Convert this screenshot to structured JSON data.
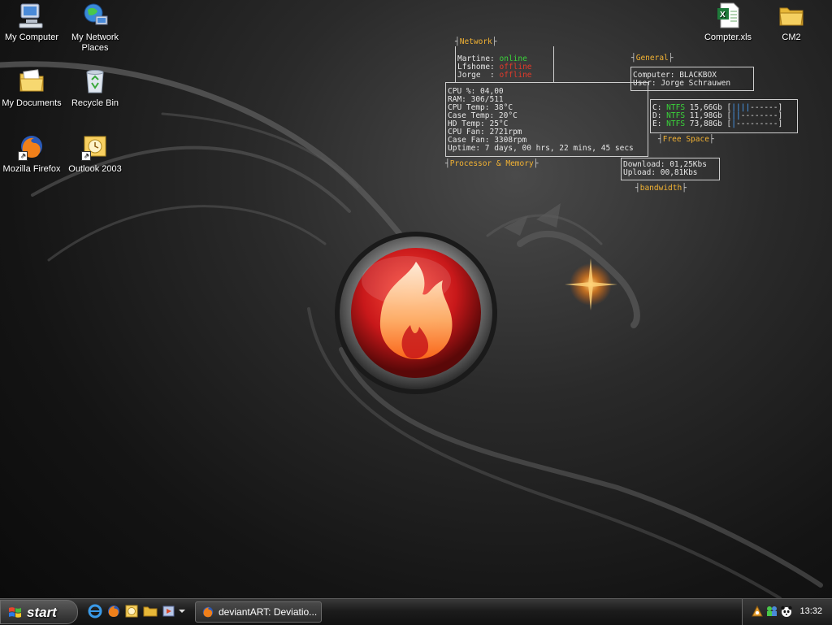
{
  "desktop_icons": [
    {
      "label": "My Computer",
      "icon": "my-computer-icon"
    },
    {
      "label": "My Network Places",
      "icon": "network-places-icon"
    },
    {
      "label": "My Documents",
      "icon": "documents-folder-icon"
    },
    {
      "label": "Recycle Bin",
      "icon": "recycle-bin-icon"
    },
    {
      "label": "Mozilla Firefox",
      "icon": "firefox-icon"
    },
    {
      "label": "Outlook 2003",
      "icon": "outlook-icon"
    },
    {
      "label": "Compter.xls",
      "icon": "excel-file-icon"
    },
    {
      "label": "CM2",
      "icon": "folder-icon"
    }
  ],
  "conky": {
    "network": {
      "title": "Network",
      "hosts": [
        {
          "name": "Martine: ",
          "status": "online"
        },
        {
          "name": "Lfshome: ",
          "status": "offline"
        },
        {
          "name": "Jorge  : ",
          "status": "offline"
        }
      ]
    },
    "general": {
      "title": "General",
      "computer": "Computer: BLACKBOX",
      "user": "User: Jorge Schrauwen"
    },
    "processor": {
      "title": "Processor & Memory",
      "lines": [
        "CPU %: 04,00",
        "RAM: 306/511",
        "CPU Temp: 38°C",
        "Case Temp: 20°C",
        "HD Temp: 25°C",
        "CPU Fan: 2721rpm",
        "Case Fan: 3308rpm",
        "Uptime: 7 days, 00 hrs, 22 mins, 45 secs"
      ]
    },
    "free_space": {
      "title": "Free Space",
      "drives": [
        {
          "drive": "C: ",
          "fs": "NTFS",
          "size": " 15,66Gb ",
          "bar_used": "||||",
          "bar_free": "------"
        },
        {
          "drive": "D: ",
          "fs": "NTFS",
          "size": " 11,98Gb ",
          "bar_used": "||",
          "bar_free": "--------"
        },
        {
          "drive": "E: ",
          "fs": "NTFS",
          "size": " 73,88Gb ",
          "bar_used": "|",
          "bar_free": "---------"
        }
      ]
    },
    "bandwidth": {
      "title": "bandwidth",
      "download": "Download: 01,25Kbs",
      "upload": "Upload: 00,81Kbs"
    }
  },
  "taskbar": {
    "start_label": "start",
    "quick_launch": [
      "internet-explorer-icon",
      "firefox-icon",
      "outlook-icon",
      "folder-icon",
      "media-icon",
      "chevron-down-icon"
    ],
    "active_task": "deviantART: Deviatio...",
    "clock": "13:32",
    "tray_icons": [
      "tray-app-icon",
      "network-people-icon",
      "panda-icon"
    ]
  },
  "colors": {
    "accent": "#f2b233",
    "online": "#3ad33a",
    "offline": "#e23a2a",
    "emblem_red": "#c8181a"
  }
}
